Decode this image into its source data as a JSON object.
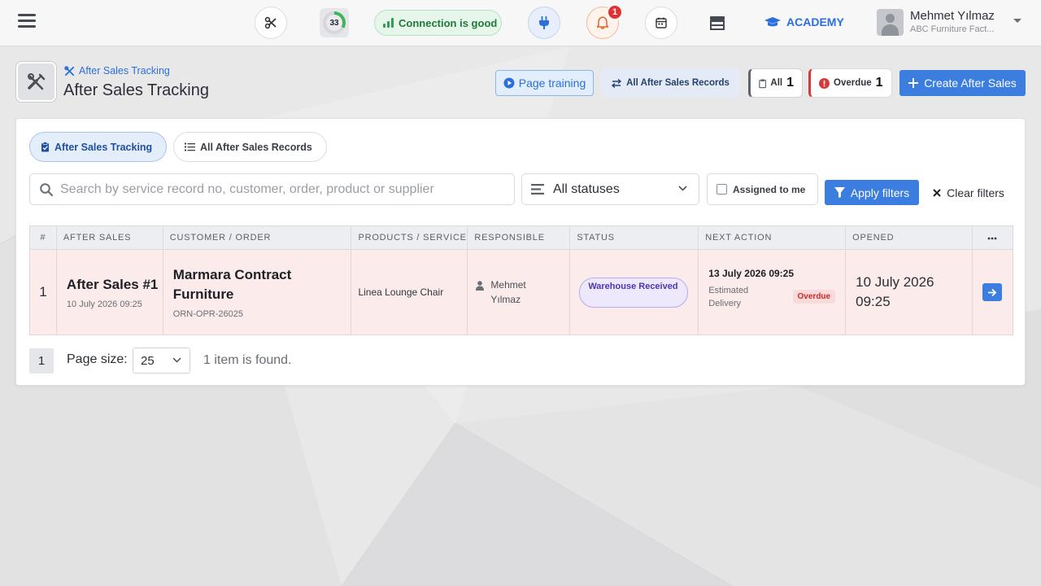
{
  "topbar": {
    "score": "33",
    "connection_label": "Connection is good",
    "notification_count": "1",
    "academy_label": "ACADEMY",
    "user_name": "Mehmet Yılmaz",
    "user_company": "ABC Furniture Fact..."
  },
  "header": {
    "breadcrumb": "After Sales Tracking",
    "title": "After Sales Tracking",
    "training_label": "Page training",
    "all_records_label": "All After Sales Records",
    "all_chip_label": "All",
    "all_chip_count": "1",
    "overdue_chip_label": "Overdue",
    "overdue_chip_count": "1",
    "create_label": "Create After Sales"
  },
  "tabs": [
    {
      "label": "After Sales Tracking",
      "active": true
    },
    {
      "label": "All After Sales Records",
      "active": false
    }
  ],
  "filters": {
    "search_placeholder": "Search by service record no, customer, order, product or supplier",
    "status_value": "All statuses",
    "assigned_label": "Assigned to me",
    "apply_label": "Apply filters",
    "clear_label": "Clear filters"
  },
  "table": {
    "columns": [
      "#",
      "AFTER SALES",
      "CUSTOMER / ORDER",
      "PRODUCTS / SERVICE",
      "RESPONSIBLE",
      "STATUS",
      "NEXT ACTION",
      "OPENED"
    ],
    "rows": [
      {
        "index": "1",
        "after_sales_title": "After Sales #1",
        "after_sales_date": "10 July 2026 09:25",
        "customer": "Marmara Contract Furniture",
        "order_no": "ORN-OPR-26025",
        "product": "Linea Lounge Chair",
        "responsible": "Mehmet Yılmaz",
        "status": "Warehouse Received",
        "next_action_date": "13 July 2026 09:25",
        "next_action_label": "Estimated Delivery",
        "next_action_flag": "Overdue",
        "opened": "10 July 2026 09:25"
      }
    ]
  },
  "footer": {
    "page": "1",
    "page_size_label": "Page size:",
    "page_size": "25",
    "found_text": "1 item is found."
  },
  "colors": {
    "accent": "#3b7ee0",
    "overdue_row": "#fbebeb",
    "status_purple": "#5233b6",
    "connection_green": "#1f7a3a"
  }
}
